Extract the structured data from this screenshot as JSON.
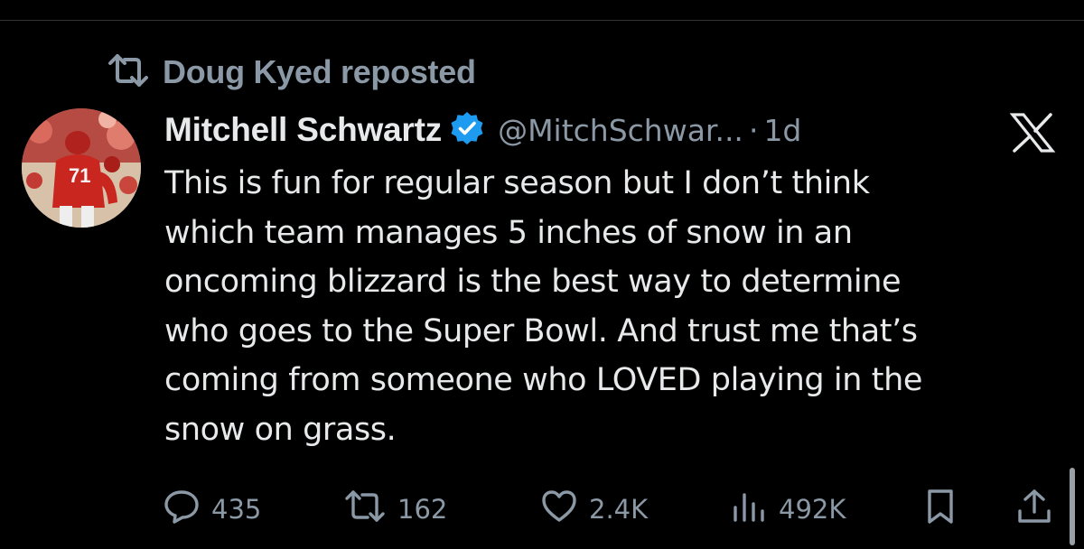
{
  "repost": {
    "icon": "repost-icon",
    "text": "Doug Kyed reposted"
  },
  "tweet": {
    "avatar": "avatar-football-player",
    "display_name": "Mitchell Schwartz",
    "verified_icon": "verified-badge-icon",
    "handle": "@MitchSchwar...",
    "separator": "·",
    "age": "1d",
    "platform_icon": "x-logo-icon",
    "text_lines": [
      "This is fun for regular season but I don’t think",
      "which team manages 5 inches of snow in an",
      "oncoming blizzard is the best way to determine",
      "who goes to the Super Bowl. And trust me that’s",
      "coming from someone who LOVED playing in the",
      "snow on grass."
    ]
  },
  "actions": {
    "reply": {
      "icon": "reply-icon",
      "count": "435"
    },
    "repost": {
      "icon": "repost-icon",
      "count": "162"
    },
    "like": {
      "icon": "heart-icon",
      "count": "2.4K"
    },
    "views": {
      "icon": "views-chart-icon",
      "count": "492K"
    },
    "bookmark": {
      "icon": "bookmark-icon"
    },
    "share": {
      "icon": "share-icon"
    }
  },
  "colors": {
    "background": "#000000",
    "text_primary": "#e7e9ea",
    "text_secondary": "#8b98a5",
    "verified_blue": "#1d9bf0"
  }
}
